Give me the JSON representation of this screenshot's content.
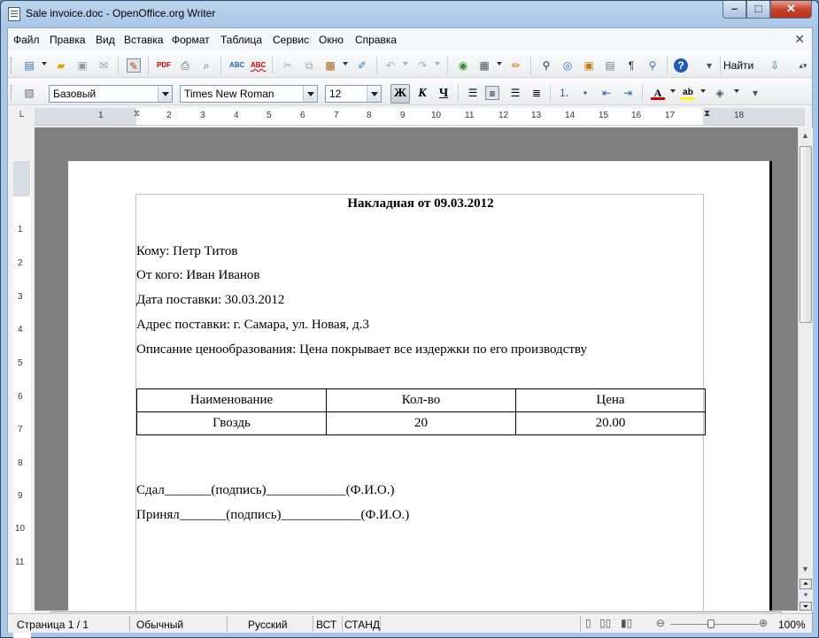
{
  "window": {
    "title": "Sale invoice.doc - OpenOffice.org Writer"
  },
  "menu": [
    "Файл",
    "Правка",
    "Вид",
    "Вставка",
    "Формат",
    "Таблица",
    "Сервис",
    "Окно",
    "Справка"
  ],
  "toolbar": {
    "find_label": "Найти"
  },
  "format": {
    "style": "Базовый",
    "font": "Times New Roman",
    "size": "12",
    "bold": "Ж",
    "italic": "К",
    "underline": "Ч"
  },
  "ruler": {
    "h_ticks": [
      "1",
      "2",
      "3",
      "4",
      "5",
      "6",
      "7",
      "8",
      "9",
      "10",
      "11",
      "12",
      "13",
      "14",
      "15",
      "16",
      "17",
      "18"
    ],
    "v_ticks": [
      "1",
      "2",
      "3",
      "4",
      "5",
      "6",
      "7",
      "8",
      "9",
      "10",
      "11"
    ]
  },
  "document": {
    "title": "Накладная от 09.03.2012",
    "fields": [
      "Кому: Петр Титов",
      "От кого: Иван Иванов",
      "Дата поставки: 30.03.2012",
      "Адрес поставки: г. Самара, ул. Новая, д.3",
      "Описание ценообразования: Цена покрывает все издержки по его производству"
    ],
    "table": {
      "headers": [
        "Наименование",
        "Кол-во",
        "Цена"
      ],
      "rows": [
        [
          "Гвоздь",
          "20",
          "20.00"
        ]
      ]
    },
    "signatures": [
      "Сдал_______(подпись)____________(Ф.И.О.)",
      "Принял_______(подпись)____________(Ф.И.О.)"
    ]
  },
  "status": {
    "page": "Страница  1 / 1",
    "style": "Обычный",
    "language": "Русский",
    "insert": "ВСТ",
    "selection": "СТАНД",
    "zoom": "100%"
  }
}
